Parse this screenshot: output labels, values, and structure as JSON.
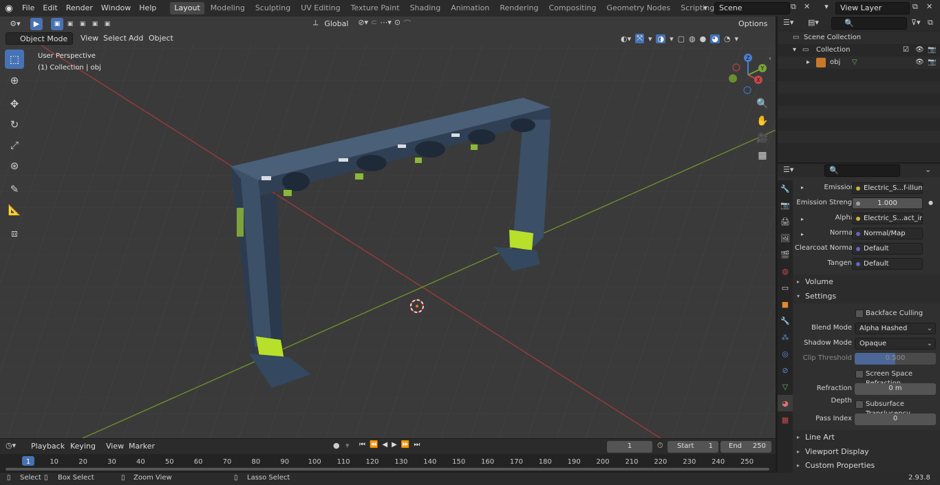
{
  "topbar": {
    "menus": [
      "File",
      "Edit",
      "Render",
      "Window",
      "Help"
    ],
    "workspaces": [
      {
        "label": "Layout",
        "active": true
      },
      {
        "label": "Modeling"
      },
      {
        "label": "Sculpting"
      },
      {
        "label": "UV Editing"
      },
      {
        "label": "Texture Paint"
      },
      {
        "label": "Shading"
      },
      {
        "label": "Animation"
      },
      {
        "label": "Rendering"
      },
      {
        "label": "Compositing"
      },
      {
        "label": "Geometry Nodes"
      },
      {
        "label": "Scripting"
      }
    ],
    "add_tab_label": "+",
    "scene_name": "Scene",
    "view_layer": "View Layer"
  },
  "viewport": {
    "mode": "Object Mode",
    "menus": [
      "View",
      "Select",
      "Add",
      "Object"
    ],
    "transform_orientation": "Global",
    "options_label": "Options",
    "overlay_title": "User Perspective",
    "overlay_subtitle": "(1) Collection | obj",
    "gizmo": {
      "x": "X",
      "y": "Y",
      "z": "Z"
    }
  },
  "outliner": {
    "search_placeholder": "",
    "items": [
      {
        "label": "Scene Collection",
        "depth": 0
      },
      {
        "label": "Collection",
        "depth": 1
      },
      {
        "label": "obj",
        "depth": 2
      }
    ]
  },
  "properties": {
    "rows": [
      {
        "label": "Emission",
        "value": "Electric_S...f-illum.png",
        "dot": "#c8b43c",
        "expand": true
      },
      {
        "label": "Emission Strengt",
        "value": "1.000",
        "dot": "#a0a0a0",
        "center": true
      },
      {
        "label": "Alpha",
        "value": "Electric_S...act_inv.pn",
        "dot": "#c8b43c",
        "expand": true
      },
      {
        "label": "Normal",
        "value": "Normal/Map",
        "dot": "#6363c7",
        "expand": true
      },
      {
        "label": "Clearcoat Normal",
        "value": "Default",
        "dot": "#6363c7"
      },
      {
        "label": "Tangent",
        "value": "Default",
        "dot": "#6363c7"
      }
    ],
    "volume_label": "Volume",
    "settings_label": "Settings",
    "backface_culling": "Backface Culling",
    "blend_mode_label": "Blend Mode",
    "blend_mode_value": "Alpha Hashed",
    "shadow_mode_label": "Shadow Mode",
    "shadow_mode_value": "Opaque",
    "clip_threshold_label": "Clip Threshold",
    "clip_threshold_value": "0.500",
    "ssr_label": "Screen Space Refraction",
    "refraction_depth_label": "Refraction Depth",
    "refraction_depth_value": "0 m",
    "subsurface_label": "Subsurface Translucency",
    "pass_index_label": "Pass Index",
    "pass_index_value": "0",
    "line_art_label": "Line Art",
    "viewport_display_label": "Viewport Display",
    "custom_props_label": "Custom Properties"
  },
  "timeline": {
    "menus": [
      "Playback",
      "Keying",
      "View",
      "Marker"
    ],
    "current_frame": "1",
    "start_label": "Start",
    "start_value": "1",
    "end_label": "End",
    "end_value": "250",
    "ticks": [
      "1",
      "10",
      "20",
      "30",
      "40",
      "50",
      "60",
      "70",
      "80",
      "90",
      "100",
      "110",
      "120",
      "130",
      "140",
      "150",
      "160",
      "170",
      "180",
      "190",
      "200",
      "210",
      "220",
      "230",
      "240",
      "250"
    ]
  },
  "statusbar": {
    "select": "Select",
    "box_select": "Box Select",
    "zoom_view": "Zoom View",
    "lasso_select": "Lasso Select",
    "version": "2.93.8"
  }
}
